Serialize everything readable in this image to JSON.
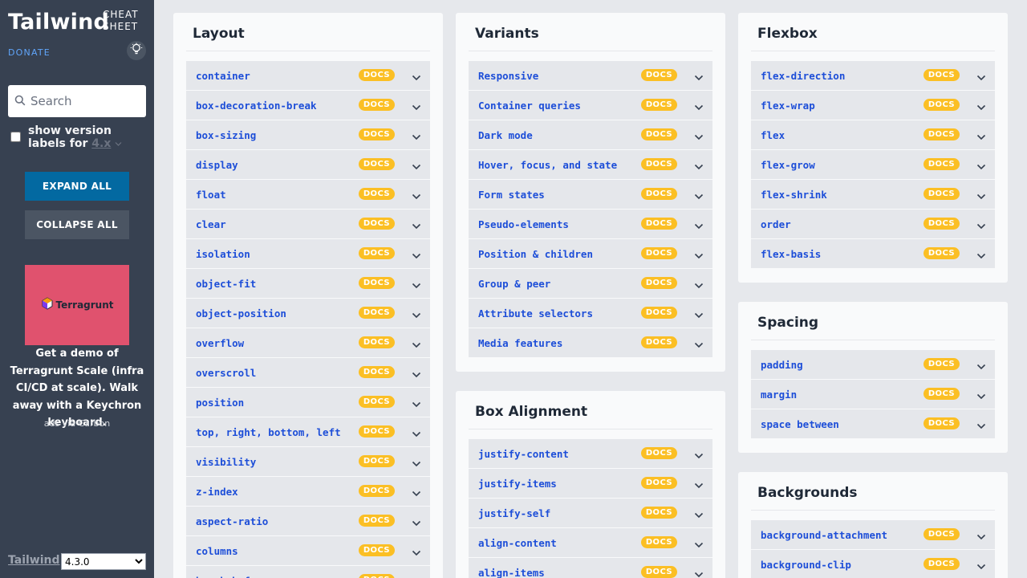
{
  "sidebar": {
    "brand": "Tailwind",
    "brand_sub_1": "CHEAT",
    "brand_sub_2": "SHEET",
    "donate": "DONATE",
    "search_placeholder": "Search",
    "version_label": "show version labels for",
    "version_value": "4.x",
    "expand_all": "EXPAND ALL",
    "collapse_all": "COLLAPSE ALL",
    "ad_logo_text": "Terragrunt",
    "ad_text": "Get a demo of Terragrunt Scale (infra CI/CD at scale). Walk away with a Keychron keyboard.",
    "ad_via": "ads via Carbon",
    "footer_link": "Tailwind",
    "footer_version": "4.3.0"
  },
  "docs_label": "DOCS",
  "layout": {
    "title": "Layout",
    "items": [
      "container",
      "box-decoration-break",
      "box-sizing",
      "display",
      "float",
      "clear",
      "isolation",
      "object-fit",
      "object-position",
      "overflow",
      "overscroll",
      "position",
      "top, right, bottom, left",
      "visibility",
      "z-index",
      "aspect-ratio",
      "columns",
      "break-before"
    ]
  },
  "variants": {
    "title": "Variants",
    "items": [
      "Responsive",
      "Container queries",
      "Dark mode",
      "Hover, focus, and state",
      "Form states",
      "Pseudo-elements",
      "Position & children",
      "Group & peer",
      "Attribute selectors",
      "Media features"
    ]
  },
  "box_alignment": {
    "title": "Box Alignment",
    "items": [
      "justify-content",
      "justify-items",
      "justify-self",
      "align-content",
      "align-items"
    ]
  },
  "flexbox": {
    "title": "Flexbox",
    "items": [
      "flex-direction",
      "flex-wrap",
      "flex",
      "flex-grow",
      "flex-shrink",
      "order",
      "flex-basis"
    ]
  },
  "spacing": {
    "title": "Spacing",
    "items": [
      "padding",
      "margin",
      "space between"
    ]
  },
  "backgrounds": {
    "title": "Backgrounds",
    "items": [
      "background-attachment",
      "background-clip"
    ]
  },
  "colors": {
    "sidebar_bg": "#374151",
    "link": "#1d4ed8",
    "docs_badge": "#fbbf24",
    "expand_btn": "#0369a1",
    "ad_bg": "#e0526e"
  }
}
